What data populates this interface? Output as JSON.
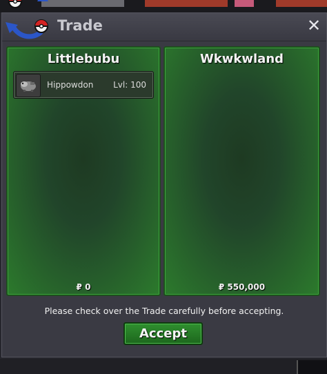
{
  "window": {
    "title": "Trade",
    "close_symbol": "✕",
    "logo_icon": "pokeball-arrows-icon"
  },
  "trade": {
    "left": {
      "player": "Littlebubu",
      "items": [
        {
          "icon": "hippowdon-icon",
          "name": "Hippowdon",
          "level": "Lvl: 100"
        }
      ],
      "money": "₽ 0"
    },
    "right": {
      "player": "Wkwkwland",
      "items": [],
      "money": "₽ 550,000"
    },
    "note": "Please check over the Trade carefully before accepting.",
    "accept_label": "Accept"
  },
  "colors": {
    "panel_green": "#2c7a2c",
    "accept_green": "#2f8f2f",
    "window_bg": "#3a3a43"
  }
}
